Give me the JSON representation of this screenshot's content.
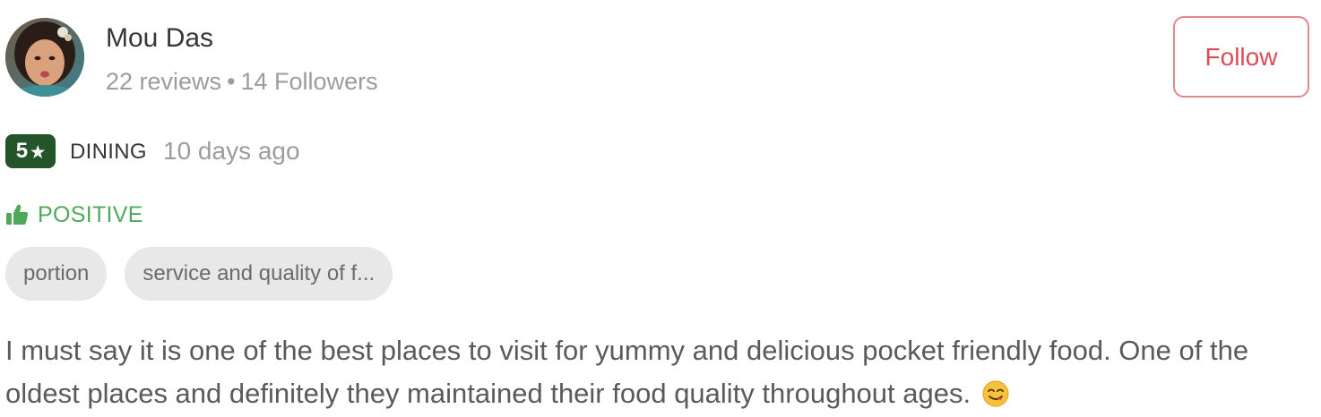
{
  "user": {
    "name": "Mou Das",
    "reviews": "22 reviews",
    "separator": "•",
    "followers": "14 Followers",
    "follow_label": "Follow",
    "avatar_icon": "user-avatar-photo"
  },
  "rating": {
    "value": "5",
    "star": "★",
    "type": "DINING",
    "time": "10 days ago",
    "badge_color": "#24542a"
  },
  "sentiment": {
    "label": "POSITIVE",
    "icon": "thumbs-up-icon",
    "color": "#4fa95a"
  },
  "tags": [
    {
      "label": "portion"
    },
    {
      "label": "service and quality of f..."
    }
  ],
  "review": {
    "text": "I must say it is one of the best places to visit for yummy and delicious pocket friendly food. One of the oldest places and definitely they maintained their food quality throughout ages.",
    "emoji": "yum-face-emoji"
  },
  "colors": {
    "follow_accent": "#dc4b57",
    "tag_bg": "#e8e8e8",
    "muted_text": "#9c9c9c"
  }
}
